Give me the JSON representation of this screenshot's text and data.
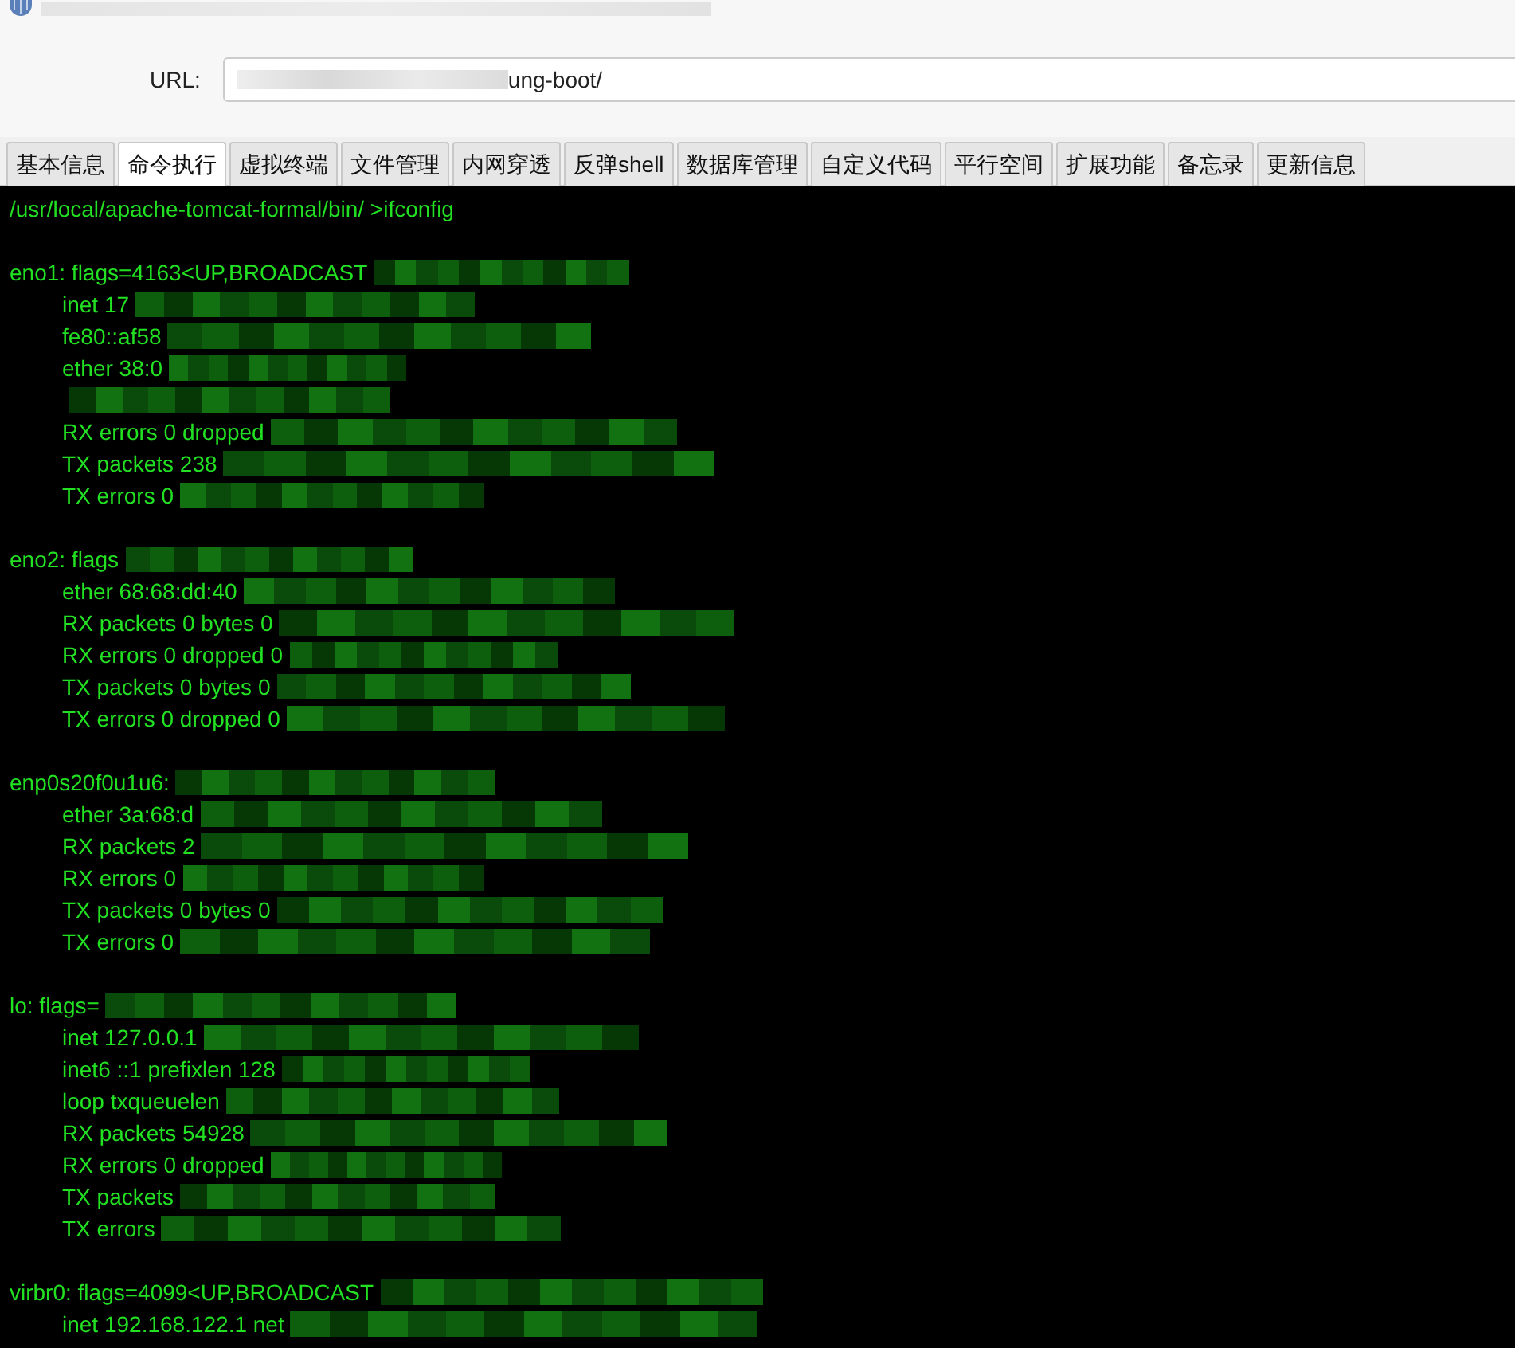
{
  "url_bar": {
    "label": "URL:",
    "value": "ung-boot/"
  },
  "tabs": [
    {
      "label": "基本信息",
      "selected": false
    },
    {
      "label": "命令执行",
      "selected": true
    },
    {
      "label": "虚拟终端",
      "selected": false
    },
    {
      "label": "文件管理",
      "selected": false
    },
    {
      "label": "内网穿透",
      "selected": false
    },
    {
      "label": "反弹shell",
      "selected": false
    },
    {
      "label": "数据库管理",
      "selected": false
    },
    {
      "label": "自定义代码",
      "selected": false
    },
    {
      "label": "平行空间",
      "selected": false
    },
    {
      "label": "扩展功能",
      "selected": false
    },
    {
      "label": "备忘录",
      "selected": false
    },
    {
      "label": "更新信息",
      "selected": false
    }
  ],
  "terminal": {
    "sections": [
      {
        "lines": [
          {
            "text": "/usr/local/apache-tomcat-formal/bin/ >ifconfig",
            "indent": false,
            "redacted": false
          }
        ]
      },
      {
        "lines": [
          {
            "text": "eno1: flags=4163<UP,BROADCAST",
            "indent": false,
            "redacted": true
          },
          {
            "text": "inet 17",
            "indent": true,
            "redacted": true
          },
          {
            "text": "fe80::af58",
            "indent": true,
            "redacted": true
          },
          {
            "text": "ether 38:0",
            "indent": true,
            "redacted": true
          },
          {
            "indent": true,
            "redacted": true
          },
          {
            "text": "RX errors 0  dropped",
            "indent": true,
            "redacted": true
          },
          {
            "text": "TX packets 238",
            "indent": true,
            "redacted": true
          },
          {
            "text": "TX errors 0",
            "indent": true,
            "redacted": true
          }
        ]
      },
      {
        "lines": [
          {
            "text": "eno2: flags",
            "indent": false,
            "redacted": true
          },
          {
            "text": "ether 68:68:dd:40",
            "indent": true,
            "redacted": true
          },
          {
            "text": "RX packets 0  bytes 0",
            "indent": true,
            "redacted": true
          },
          {
            "text": "RX errors 0  dropped 0",
            "indent": true,
            "redacted": true
          },
          {
            "text": "TX packets 0  bytes 0",
            "indent": true,
            "redacted": true
          },
          {
            "text": "TX errors 0  dropped 0",
            "indent": true,
            "redacted": true
          }
        ]
      },
      {
        "lines": [
          {
            "text": "enp0s20f0u1u6:",
            "indent": false,
            "redacted": true
          },
          {
            "text": "ether 3a:68:d",
            "indent": true,
            "redacted": true
          },
          {
            "text": "RX packets 2",
            "indent": true,
            "redacted": true
          },
          {
            "text": "RX errors 0",
            "indent": true,
            "redacted": true
          },
          {
            "text": "TX packets 0  bytes 0",
            "indent": true,
            "redacted": true
          },
          {
            "text": "TX errors 0",
            "indent": true,
            "redacted": true
          }
        ]
      },
      {
        "lines": [
          {
            "text": "lo: flags=",
            "indent": false,
            "redacted": true
          },
          {
            "text": "inet 127.0.0.1",
            "indent": true,
            "redacted": true
          },
          {
            "text": "inet6 ::1  prefixlen 128",
            "indent": true,
            "redacted": true
          },
          {
            "text": "loop  txqueuelen",
            "indent": true,
            "redacted": true
          },
          {
            "text": "RX packets 54928",
            "indent": true,
            "redacted": true
          },
          {
            "text": "RX errors 0  dropped",
            "indent": true,
            "redacted": true
          },
          {
            "text": "TX packets",
            "indent": true,
            "redacted": true
          },
          {
            "text": "TX errors",
            "indent": true,
            "redacted": true
          }
        ]
      },
      {
        "lines": [
          {
            "text": "virbr0: flags=4099<UP,BROADCAST",
            "indent": false,
            "redacted": true
          },
          {
            "text": "inet 192.168.122.1  net",
            "indent": true,
            "redacted": true
          }
        ]
      }
    ]
  }
}
